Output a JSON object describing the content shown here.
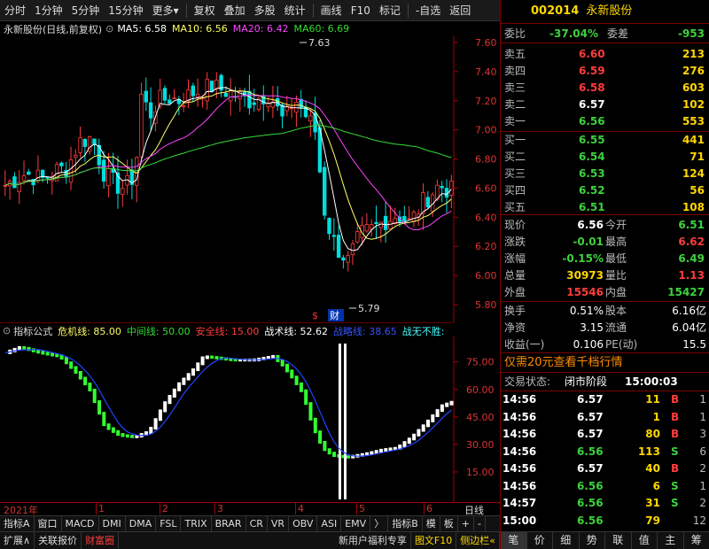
{
  "toolbar": {
    "items": [
      "分时",
      "1分钟",
      "5分钟",
      "15分钟",
      "更多▾",
      "复权",
      "叠加",
      "多股",
      "统计",
      "画线",
      "F10",
      "标记",
      "-自选",
      "返回"
    ]
  },
  "chart_info": {
    "title": "永新股份(日线,前复权)",
    "ma5": "MA5: 6.58",
    "ma10": "MA10: 6.56",
    "ma20": "MA20: 6.42",
    "ma60": "MA60: 6.69",
    "high_label": "7.63",
    "low_label": "5.79",
    "cai": "财",
    "dollar": "$"
  },
  "price_axis": [
    "7.60",
    "7.40",
    "7.20",
    "7.00",
    "6.80",
    "6.60",
    "6.40",
    "6.20",
    "6.00",
    "5.80"
  ],
  "indicator_info": {
    "name": "指标公式",
    "l1": "危机线: 85.00",
    "l2": "中间线: 50.00",
    "l3": "安全线: 15.00",
    "l4": "战术线: 52.62",
    "l5": "战略线: 38.65",
    "l6": "战无不胜:"
  },
  "ind_axis": [
    "75.00",
    "60.00",
    "45.00",
    "30.00",
    "15.00"
  ],
  "xaxis": {
    "year": "2021年",
    "months": [
      "1",
      "2",
      "3",
      "4",
      "5",
      "6"
    ],
    "right": "日线"
  },
  "bottom_tabs": [
    "指标A",
    "窗口",
    "MACD",
    "DMI",
    "DMA",
    "FSL",
    "TRIX",
    "BRAR",
    "CR",
    "VR",
    "OBV",
    "ASI",
    "EMV",
    "〉",
    "指标B",
    "模",
    "板",
    "+",
    "-"
  ],
  "bottom_bar": [
    "扩展∧",
    "关联报价",
    "财富圈",
    "新用户福利专享",
    "图文F10",
    "侧边栏«"
  ],
  "quote": {
    "code": "002014",
    "name": "永新股份",
    "weibi_label": "委比",
    "weibi": "-37.04%",
    "weicha_label": "委差",
    "weicha": "-953",
    "asks": [
      {
        "label": "卖五",
        "price": "6.60",
        "vol": "213"
      },
      {
        "label": "卖四",
        "price": "6.59",
        "vol": "276"
      },
      {
        "label": "卖三",
        "price": "6.58",
        "vol": "603"
      },
      {
        "label": "卖二",
        "price": "6.57",
        "vol": "102"
      },
      {
        "label": "卖一",
        "price": "6.56",
        "vol": "553"
      }
    ],
    "bids": [
      {
        "label": "买一",
        "price": "6.55",
        "vol": "441"
      },
      {
        "label": "买二",
        "price": "6.54",
        "vol": "71"
      },
      {
        "label": "买三",
        "price": "6.53",
        "vol": "124"
      },
      {
        "label": "买四",
        "price": "6.52",
        "vol": "56"
      },
      {
        "label": "买五",
        "price": "6.51",
        "vol": "108"
      }
    ],
    "stats": [
      {
        "l1": "现价",
        "v1": "6.56",
        "l2": "今开",
        "v2": "6.51"
      },
      {
        "l1": "涨跌",
        "v1": "-0.01",
        "l2": "最高",
        "v2": "6.62"
      },
      {
        "l1": "涨幅",
        "v1": "-0.15%",
        "l2": "最低",
        "v2": "6.49"
      },
      {
        "l1": "总量",
        "v1": "30973",
        "l2": "量比",
        "v2": "1.13"
      },
      {
        "l1": "外盘",
        "v1": "15546",
        "l2": "内盘",
        "v2": "15427"
      }
    ],
    "fund": [
      {
        "l1": "换手",
        "v1": "0.51%",
        "l2": "股本",
        "v2": "6.16亿"
      },
      {
        "l1": "净资",
        "v1": "3.15",
        "l2": "流通",
        "v2": "6.04亿"
      },
      {
        "l1": "收益(一)",
        "v1": "0.106",
        "l2": "PE(动)",
        "v2": "15.5"
      }
    ],
    "promo": "仅需20元查看千档行情",
    "status_label": "交易状态:",
    "status": "闭市阶段",
    "status_time": "15:00:03",
    "ticks": [
      {
        "t": "14:56",
        "p": "6.57",
        "v": "11",
        "s": "B",
        "n": "1"
      },
      {
        "t": "14:56",
        "p": "6.57",
        "v": "1",
        "s": "B",
        "n": "1"
      },
      {
        "t": "14:56",
        "p": "6.57",
        "v": "80",
        "s": "B",
        "n": "3"
      },
      {
        "t": "14:56",
        "p": "6.56",
        "v": "113",
        "s": "S",
        "n": "6"
      },
      {
        "t": "14:56",
        "p": "6.57",
        "v": "40",
        "s": "B",
        "n": "2"
      },
      {
        "t": "14:56",
        "p": "6.56",
        "v": "6",
        "s": "S",
        "n": "1"
      },
      {
        "t": "14:57",
        "p": "6.56",
        "v": "31",
        "s": "S",
        "n": "2"
      },
      {
        "t": "15:00",
        "p": "6.56",
        "v": "79",
        "s": "",
        "n": "12"
      }
    ],
    "tabs": [
      "笔",
      "价",
      "细",
      "势",
      "联",
      "值",
      "主",
      "筹"
    ]
  },
  "colors": {
    "up": "#ff3c3c",
    "down": "#3ed13e",
    "ma5": "#ffffff",
    "ma10": "#ffff66",
    "ma20": "#ff44ff",
    "ma60": "#33dd33"
  }
}
